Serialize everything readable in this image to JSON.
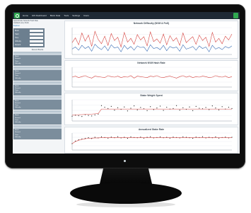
{
  "navbar": {
    "items": [
      "Home",
      "GIS Dashboard",
      "Block Data",
      "Tools",
      "Settings",
      "Users"
    ]
  },
  "sidebar": {
    "intro_lines": [
      "Approximate Network Hash Rate",
      "Updated every block",
      "Explorer"
    ],
    "summary": [
      {
        "key": "Block",
        "value": ""
      },
      {
        "key": "Hash",
        "value": ""
      },
      {
        "key": "Time",
        "value": ""
      },
      {
        "key": "Difficulty",
        "value": ""
      },
      {
        "key": "Reward",
        "value": ""
      }
    ],
    "section_title": "Recent Blocks",
    "cards": [
      {
        "head": "",
        "lines": [
          "Block:",
          "Reward:",
          "Time:",
          "Difficulty:"
        ]
      },
      {
        "head": "",
        "lines": [
          "Block:",
          "Reward:",
          "Time:",
          "Difficulty:"
        ]
      },
      {
        "head": "",
        "lines": [
          "Block:",
          "Reward:",
          "Time:",
          "Difficulty:"
        ]
      },
      {
        "head": "",
        "lines": [
          "Block:",
          "Reward:",
          "Time:",
          "Difficulty:"
        ]
      },
      {
        "head": "",
        "lines": [
          "Block:",
          "Reward:",
          "Time:",
          "Difficulty:"
        ]
      },
      {
        "head": "",
        "lines": [
          "Block:",
          "Reward:",
          "Time:",
          "Difficulty:"
        ]
      }
    ]
  },
  "colors": {
    "navbar": "#1f2a35",
    "accent_green": "#2fa84f",
    "series_red": "#d64541",
    "series_blue": "#3b6fb6",
    "series_black": "#222222"
  },
  "chart_data": [
    {
      "type": "line",
      "title": "Network Difficulty (NVM & PoS)",
      "series": [
        {
          "values": [
            52,
            61,
            48,
            70,
            55,
            66,
            45,
            73,
            58,
            50,
            64,
            47,
            69,
            56,
            62,
            44,
            71,
            53,
            60,
            49,
            67,
            57,
            63,
            46,
            72,
            54,
            59,
            51,
            68,
            48,
            65,
            55,
            61,
            47,
            70,
            52,
            58,
            63,
            49,
            66,
            56,
            62,
            45,
            71,
            53,
            60,
            50,
            64,
            57,
            68
          ]
        },
        {
          "values": [
            40,
            44,
            38,
            47,
            41,
            45,
            36,
            49,
            43,
            39,
            46,
            37,
            48,
            42,
            44,
            35,
            47,
            40,
            45,
            38,
            46,
            43,
            44,
            36,
            48,
            41,
            43,
            39,
            47,
            37,
            45,
            42,
            44,
            36,
            48,
            40,
            42,
            45,
            38,
            46,
            41,
            44,
            35,
            47,
            40,
            43,
            39,
            45,
            42,
            46
          ]
        }
      ],
      "ylim": [
        30,
        80
      ]
    },
    {
      "type": "line",
      "title": "Network NVM Hash Rate",
      "series": [
        {
          "values": [
            50,
            52,
            49,
            51,
            53,
            50,
            48,
            52,
            51,
            50,
            49,
            53,
            51,
            50,
            52,
            49,
            51,
            50,
            53,
            48,
            52,
            51,
            50,
            49,
            52,
            51,
            53,
            50,
            49,
            51,
            52,
            50,
            48,
            51,
            53,
            50,
            52,
            49,
            51,
            50,
            52,
            51,
            49,
            50,
            53,
            51,
            50,
            52,
            49,
            51
          ]
        }
      ],
      "ylim": [
        30,
        70
      ]
    },
    {
      "type": "scatter",
      "title": "Stake Weight Spent",
      "series": [
        {
          "values": [
            18,
            22,
            20,
            17,
            24,
            21,
            19,
            23,
            26,
            58,
            52,
            47,
            55,
            41,
            50,
            44,
            53,
            38,
            48,
            57,
            42,
            51,
            46,
            39,
            54,
            43,
            49,
            56,
            40,
            52,
            45,
            47,
            58,
            41,
            50,
            44,
            53,
            39,
            55,
            48,
            46,
            51,
            43,
            57,
            49,
            42,
            54,
            45,
            52,
            47
          ]
        }
      ],
      "trend": [
        22,
        23,
        24,
        24,
        25,
        26,
        26,
        27,
        28,
        45,
        45,
        45,
        45,
        45,
        45,
        45,
        45,
        45,
        45,
        45,
        45,
        45,
        45,
        45,
        45,
        45,
        45,
        45,
        45,
        45,
        45,
        45,
        45,
        45,
        45,
        45,
        45,
        45,
        45,
        45,
        45,
        45,
        45,
        45,
        45,
        45,
        45,
        45,
        45,
        45
      ],
      "ylim": [
        0,
        80
      ]
    },
    {
      "type": "scatter",
      "title": "Annualized Stake Rate",
      "series": [
        {
          "values": [
            30,
            42,
            48,
            52,
            55,
            58,
            54,
            60,
            57,
            62,
            59,
            56,
            61,
            58,
            63,
            57,
            60,
            55,
            62,
            59,
            58,
            61,
            56,
            60,
            63,
            57,
            59,
            62,
            58,
            60,
            56,
            61,
            59,
            57,
            62,
            60,
            58,
            55,
            61,
            59,
            63,
            57,
            60,
            58,
            62,
            56,
            59,
            61,
            57,
            60
          ]
        }
      ],
      "trend": [
        30,
        40,
        46,
        50,
        53,
        55,
        56,
        57,
        57,
        58,
        58,
        58,
        58,
        58,
        58,
        58,
        58,
        58,
        58,
        58,
        58,
        58,
        58,
        58,
        58,
        58,
        58,
        58,
        58,
        58,
        58,
        58,
        58,
        58,
        58,
        58,
        58,
        58,
        58,
        58,
        58,
        58,
        58,
        58,
        58,
        58,
        58,
        58,
        58,
        58
      ],
      "ylim": [
        0,
        80
      ]
    }
  ]
}
